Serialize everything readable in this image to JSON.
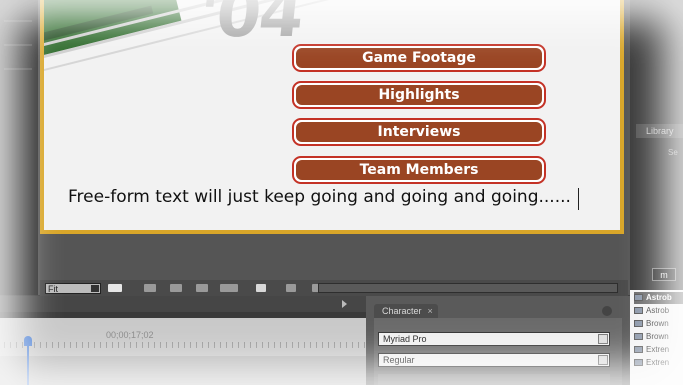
{
  "program_monitor": {
    "title_text": "'04",
    "menu_buttons": [
      {
        "label": "Game Footage"
      },
      {
        "label": "Highlights"
      },
      {
        "label": "Interviews"
      },
      {
        "label": "Team Members"
      }
    ],
    "freeform_text": "Free-form text will just keep going and going and going......",
    "zoom_select": "Fit"
  },
  "timeline": {
    "timecode": "00;00;17;02"
  },
  "character_panel": {
    "tab_label": "Character",
    "tab_close": "×",
    "font_family": "Myriad Pro",
    "font_style": "Regular"
  },
  "library_panel": {
    "tab_label": "Library",
    "sub_label": "Se",
    "badge": "m",
    "items": [
      {
        "label": "Astrob"
      },
      {
        "label": "Astrob"
      },
      {
        "label": "Brown"
      },
      {
        "label": "Brown"
      },
      {
        "label": "Extren"
      },
      {
        "label": "Extren"
      }
    ]
  },
  "colors": {
    "button_fill": "#9a4523",
    "button_border": "#c43226",
    "canvas_border": "#d9a629",
    "playhead": "#4a7ed3"
  }
}
